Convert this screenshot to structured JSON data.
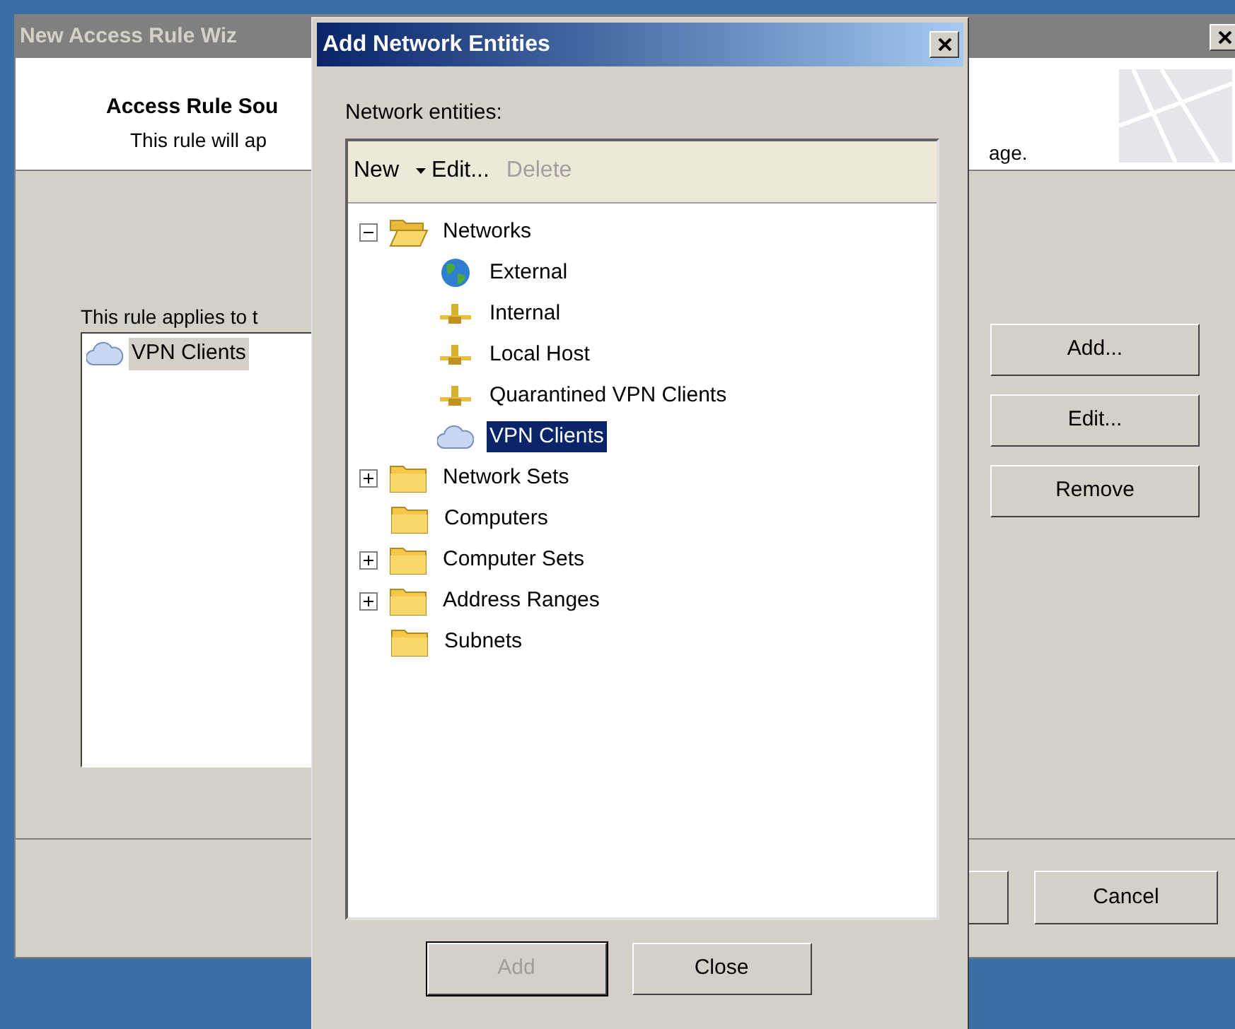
{
  "background_window": {
    "title": "New Access Rule Wiz",
    "header_title": "Access Rule Sou",
    "header_text": "This rule will ap",
    "header_text_end": "age.",
    "body_label": "This rule applies to t",
    "list_items": [
      {
        "label": "VPN Clients",
        "selected": true
      }
    ],
    "side_buttons": [
      "Add...",
      "Edit...",
      "Remove"
    ],
    "bottom_buttons": [
      "Cancel"
    ]
  },
  "dialog": {
    "title": "Add Network Entities",
    "label": "Network entities:",
    "toolbar": [
      {
        "label": "New",
        "kind": "dropdown",
        "disabled": false
      },
      {
        "label": "Edit...",
        "kind": "plain",
        "disabled": false
      },
      {
        "label": "Delete",
        "kind": "plain",
        "disabled": true
      }
    ],
    "tree": [
      {
        "label": "Networks",
        "kind": "folder",
        "expanded": true,
        "selected": false,
        "children": [
          {
            "label": "External",
            "kind": "globe",
            "selected": false
          },
          {
            "label": "Internal",
            "kind": "network",
            "selected": false
          },
          {
            "label": "Local Host",
            "kind": "network",
            "selected": false
          },
          {
            "label": "Quarantined VPN Clients",
            "kind": "network",
            "selected": false
          },
          {
            "label": "VPN Clients",
            "kind": "cloud",
            "selected": true
          }
        ]
      },
      {
        "label": "Network Sets",
        "kind": "folder",
        "expanded": false,
        "selected": false
      },
      {
        "label": "Computers",
        "kind": "folder",
        "selected": false
      },
      {
        "label": "Computer Sets",
        "kind": "folder",
        "expanded": false,
        "selected": false
      },
      {
        "label": "Address Ranges",
        "kind": "folder",
        "expanded": false,
        "selected": false
      },
      {
        "label": "Subnets",
        "kind": "folder",
        "selected": false
      }
    ],
    "buttons": [
      {
        "label": "Add",
        "disabled": true
      },
      {
        "label": "Close",
        "disabled": false
      }
    ]
  }
}
